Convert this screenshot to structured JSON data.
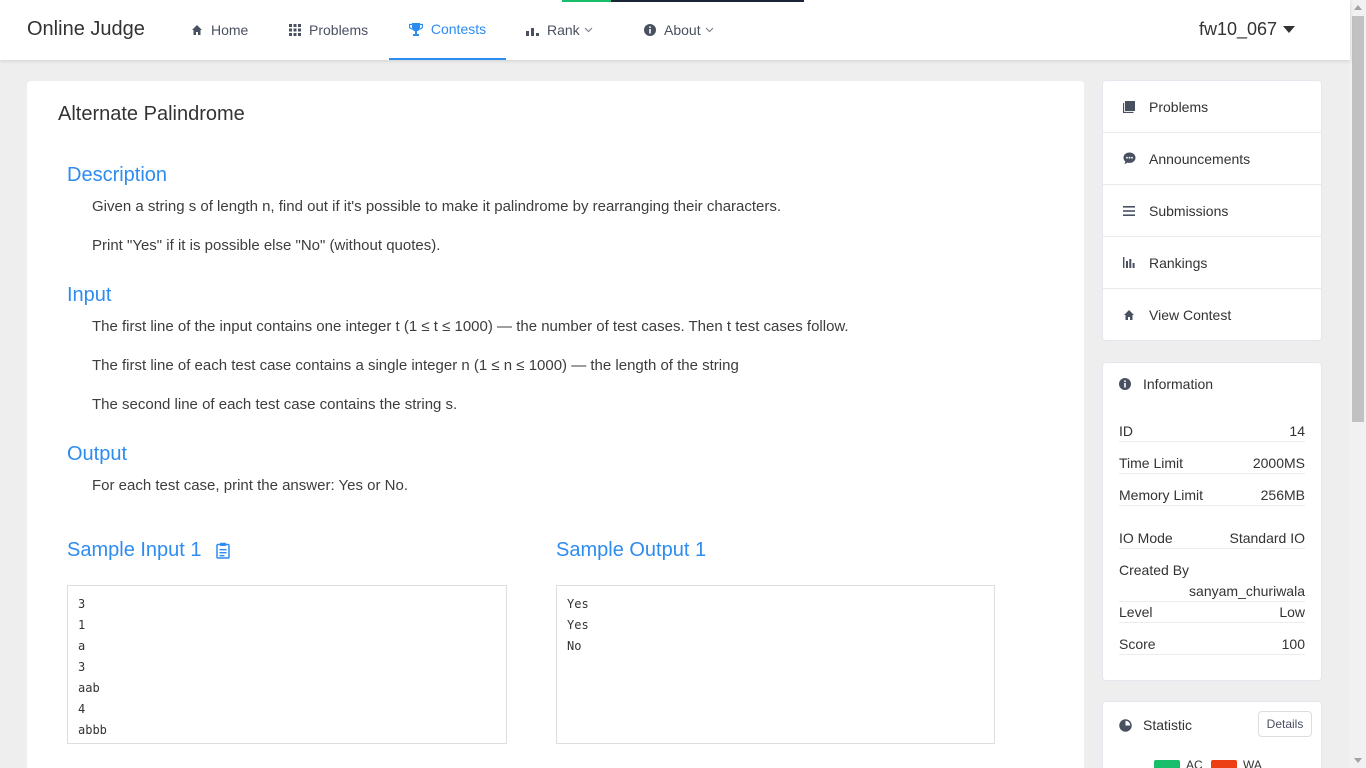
{
  "header": {
    "logo": "Online Judge",
    "nav": [
      {
        "label": "Home",
        "icon": "home-icon"
      },
      {
        "label": "Problems",
        "icon": "grid-icon"
      },
      {
        "label": "Contests",
        "icon": "trophy-icon",
        "active": true
      },
      {
        "label": "Rank",
        "icon": "bar-chart-icon",
        "dropdown": true
      },
      {
        "label": "About",
        "icon": "info-circle-icon",
        "dropdown": true
      }
    ],
    "username": "fw10_067"
  },
  "problem": {
    "title": "Alternate Palindrome",
    "description_title": "Description",
    "description": [
      "Given a string s of length n, find out if it's possible to make it palindrome by rearranging their characters.",
      "Print \"Yes\" if it is possible else \"No\" (without quotes)."
    ],
    "input_title": "Input",
    "input": [
      "The first line of the input contains one integer t (1 ≤ t ≤ 1000) — the number of test cases. Then t test cases follow.",
      "The first line of each test case contains a single integer n (1 ≤ n ≤ 1000) — the length of the string",
      "The second line of each test case contains the string s."
    ],
    "output_title": "Output",
    "output": [
      "For each test case, print the answer: Yes or No."
    ],
    "sample_input_title": "Sample Input 1",
    "sample_output_title": "Sample Output 1",
    "sample_input": [
      "3",
      "1",
      "a",
      "3",
      "aab",
      "4",
      "abbb"
    ],
    "sample_output": [
      "Yes",
      "Yes",
      "No"
    ]
  },
  "sidebar": {
    "menu": [
      {
        "label": "Problems",
        "icon": "book-icon"
      },
      {
        "label": "Announcements",
        "icon": "chat-icon"
      },
      {
        "label": "Submissions",
        "icon": "list-icon"
      },
      {
        "label": "Rankings",
        "icon": "bar-chart-icon"
      },
      {
        "label": "View Contest",
        "icon": "home-icon"
      }
    ],
    "information": {
      "title": "Information",
      "id_label": "ID",
      "id": "14",
      "time_label": "Time Limit",
      "time": "2000MS",
      "memory_label": "Memory Limit",
      "memory": "256MB",
      "io_label": "IO Mode",
      "io": "Standard IO",
      "created_label": "Created By",
      "created": "sanyam_churiwala",
      "level_label": "Level",
      "level": "Low",
      "score_label": "Score",
      "score": "100"
    },
    "statistic": {
      "title": "Statistic",
      "details": "Details",
      "legend": [
        {
          "label": "AC",
          "color": "#19be6b"
        },
        {
          "label": "WA",
          "color": "#ed3f14"
        }
      ]
    }
  },
  "colors": {
    "accent": "#2d8cf0",
    "accepted": "#19be6b",
    "wrong_answer": "#ed3f14"
  }
}
